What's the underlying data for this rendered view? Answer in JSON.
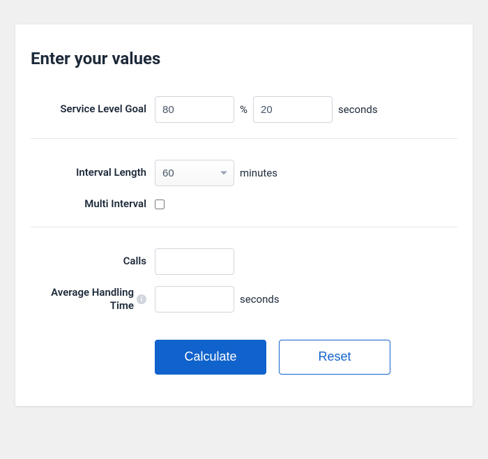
{
  "title": "Enter your values",
  "fields": {
    "serviceLevelGoal": {
      "label": "Service Level Goal",
      "percentValue": "80",
      "percentSymbol": "%",
      "secondsValue": "20",
      "unit": "seconds"
    },
    "intervalLength": {
      "label": "Interval Length",
      "value": "60",
      "unit": "minutes"
    },
    "multiInterval": {
      "label": "Multi Interval",
      "checked": false
    },
    "calls": {
      "label": "Calls",
      "value": ""
    },
    "avgHandlingTime": {
      "label": "Average Handling Time",
      "value": "",
      "unit": "seconds"
    }
  },
  "buttons": {
    "calculate": "Calculate",
    "reset": "Reset"
  }
}
